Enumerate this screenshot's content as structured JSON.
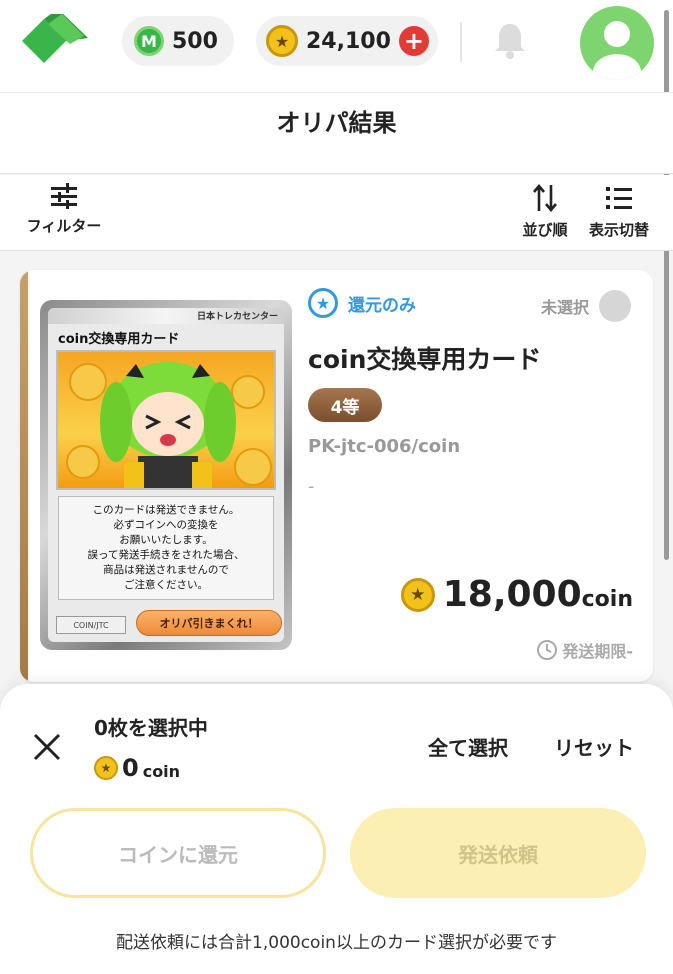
{
  "header": {
    "m_points": "500",
    "coins": "24,100",
    "m_badge": "M",
    "plus": "+",
    "logo_icon": "diamond-logo",
    "bell_icon": "bell-icon",
    "avatar_icon": "user-avatar",
    "accent": "#3ab54a"
  },
  "page": {
    "title": "オリパ結果"
  },
  "toolbar": {
    "filter_label": "フィルター",
    "sort_label": "並び順",
    "view_label": "表示切替"
  },
  "card": {
    "return_label": "還元のみ",
    "unselected_label": "未選択",
    "title": "coin交換専用カード",
    "rank": "4等",
    "code": "PK-jtc-006/coin",
    "dash": "-",
    "price_value": "18,000",
    "price_unit": "coin",
    "deadline": "発送期限-",
    "image": {
      "brand": "日本トレカセンター",
      "name": "coin交換専用カード",
      "lines": [
        "このカードは発送できません。",
        "必ずコインへの変換を",
        "お願いいたします。",
        "誤って発送手続きをされた場合、",
        "商品は発送されませんので",
        "ご注意ください。"
      ],
      "code": "COIN/JTC",
      "button": "オリパ引きまくれ！"
    }
  },
  "sheet": {
    "selected_count": "0枚を選択中",
    "coin_value": "0",
    "coin_unit": "coin",
    "select_all": "全て選択",
    "reset": "リセット",
    "return_button": "コインに還元",
    "ship_button": "発送依頼",
    "notice": "配送依頼には合計1,000coin以上のカード選択が必要です"
  },
  "colors": {
    "blue": "#2f9ae0",
    "coin_gold": "#f2c21b",
    "rank_bronze": "#8b5e3c",
    "ship_yellow": "#fcefb3"
  }
}
